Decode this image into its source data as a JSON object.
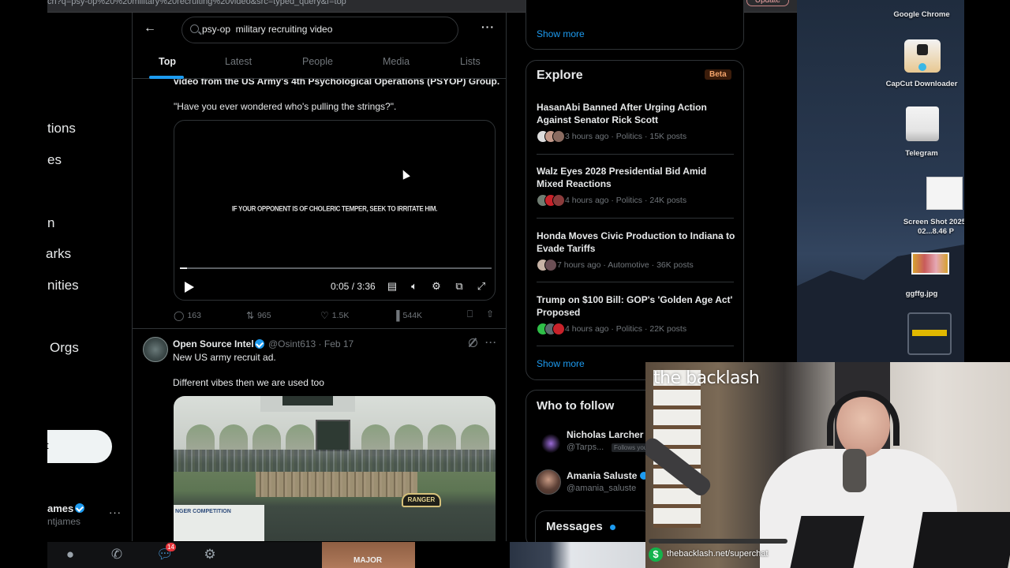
{
  "browser": {
    "url_fragment": "ch?q=psy-op%20%20military%20recruiting%20video&src=typed_query&f=top",
    "update_label": "Update"
  },
  "sidebar": {
    "items": [
      {
        "label": "tions"
      },
      {
        "label": "es"
      },
      {
        "label": "n"
      },
      {
        "label": "arks"
      },
      {
        "label": "nities"
      },
      {
        "label": "Orgs"
      }
    ],
    "post_label": "t",
    "account": {
      "name": "ames",
      "handle": "ntjames",
      "verified": true,
      "more": "···"
    }
  },
  "search": {
    "back": "←",
    "query": "psy-op  military recruiting video",
    "more": "···",
    "tabs": [
      {
        "label": "Top",
        "active": true
      },
      {
        "label": "Latest",
        "active": false
      },
      {
        "label": "People",
        "active": false
      },
      {
        "label": "Media",
        "active": false
      },
      {
        "label": "Lists",
        "active": false
      }
    ]
  },
  "tweet1": {
    "text_line1": "video from the US Army's 4th Psychological Operations (PSYOP) Group.",
    "text_line2": "\"Have you ever wondered who's pulling the strings?\".",
    "video": {
      "caption": "IF YOUR OPPONENT IS OF CHOLERIC TEMPER, SEEK TO IRRITATE HIM.",
      "time": "0:05 / 3:36",
      "progress": 0.023
    },
    "actions": {
      "replies": "163",
      "reposts": "965",
      "likes": "1.5K",
      "views": "544K"
    }
  },
  "tweet2": {
    "name": "Open Source Intel",
    "verified": true,
    "meta": "@Osint613 · Feb 17",
    "line1": "New US army recruit ad.",
    "line2": "Different vibes then we are used too",
    "media": {
      "banner_text": "NGER COMPETITION",
      "tab_text": "RANGER"
    }
  },
  "right": {
    "top_show_more": "Show more",
    "explore": {
      "title": "Explore",
      "badge": "Beta",
      "items": [
        {
          "title": "HasanAbi Banned After Urging Action Against Senator Rick Scott",
          "meta": "3 hours ago · Politics · 15K posts"
        },
        {
          "title": "Walz Eyes 2028 Presidential Bid Amid Mixed Reactions",
          "meta": "4 hours ago · Politics · 24K posts"
        },
        {
          "title": "Honda Moves Civic Production to Indiana to Evade Tariffs",
          "meta": "7 hours ago · Automotive · 36K posts"
        },
        {
          "title": "Trump on $100 Bill: GOP's 'Golden Age Act' Proposed",
          "meta": "4 hours ago · Politics · 22K posts"
        }
      ],
      "show_more": "Show more"
    },
    "who_to_follow": {
      "title": "Who to follow",
      "users": [
        {
          "name": "Nicholas Larcher",
          "handle": "@Tarps...",
          "badge": "Follows you"
        },
        {
          "name": "Amania Saluste",
          "handle": "@amania_saluste",
          "verified": true
        }
      ]
    },
    "messages": {
      "title": "Messages"
    }
  },
  "desktop": {
    "icons": [
      {
        "label": "Google Chrome"
      },
      {
        "label": "CapCut Downloader"
      },
      {
        "label": "Telegram"
      },
      {
        "label": "Screen Shot 2025-02...8.46 P"
      },
      {
        "label": "ggffg.jpg"
      }
    ]
  },
  "webcam": {
    "title": "the backlash",
    "url": "thebacklash.net/superchat",
    "dollar": "$"
  },
  "dock": {
    "badge": "14",
    "thumb_text": "MAJOR"
  }
}
